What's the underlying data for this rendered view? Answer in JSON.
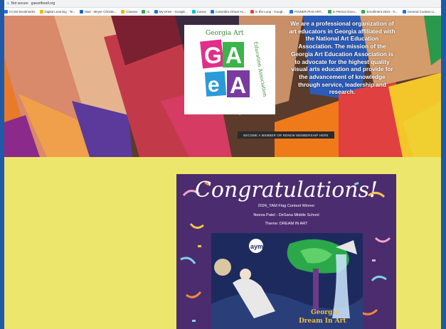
{
  "browser": {
    "security_label": "Not secure",
    "url": "gaeartforall.org"
  },
  "bookmarks": [
    {
      "label": "CCSD Bookmarks",
      "color": "#1a73e8"
    },
    {
      "label": "Digital Learning - Te...",
      "color": "#f4b400"
    },
    {
      "label": "Mail - Meyer Christin...",
      "color": "#0f6cbd"
    },
    {
      "label": "Classes",
      "color": "#f4b400"
    },
    {
      "label": "IC",
      "color": "#34a853"
    },
    {
      "label": "My Drive - Google...",
      "color": "#1a73e8"
    },
    {
      "label": "Canva",
      "color": "#00c4cc"
    },
    {
      "label": "Columbia Virtual Ac...",
      "color": "#1a73e8"
    },
    {
      "label": "In the Loop - Googl...",
      "color": "#ea4335"
    },
    {
      "label": "POWER PHS ART...",
      "color": "#1a73e8"
    },
    {
      "label": "In Person Docu...",
      "color": "#34a853"
    },
    {
      "label": "Enrollment 2024 - G...",
      "color": "#34a853"
    },
    {
      "label": "General Contact Li...",
      "color": "#1a73e8"
    },
    {
      "label": "S_VISUAL ART YE...",
      "color": "#1a73e8"
    }
  ],
  "logo": {
    "top_text": "Georgia Art",
    "side_text": "Education Association",
    "letters": [
      "G",
      "A",
      "e",
      "A"
    ]
  },
  "mission": {
    "text": "We are a professional organization of art educators in Georgia affiliated with the National Art Education Association. The mission of the Georgia Art Education Association is to advocate for the highest quality visual arts education and provide for the advancement of knowledge through service, leadership and research."
  },
  "member_button": "BECOME A MEMBER OR RENEW MEMBERSHIP HERE",
  "card": {
    "title": "Congratulations!",
    "line1": "2024_YAM Flag Contest Winner",
    "line2": "Neeva Patel - DeSana Middle School",
    "line3": "Theme: DREAM IN ART",
    "art_badge": "aym",
    "art_caption_1": "Georgia",
    "art_caption_2": "Dream In Art"
  }
}
